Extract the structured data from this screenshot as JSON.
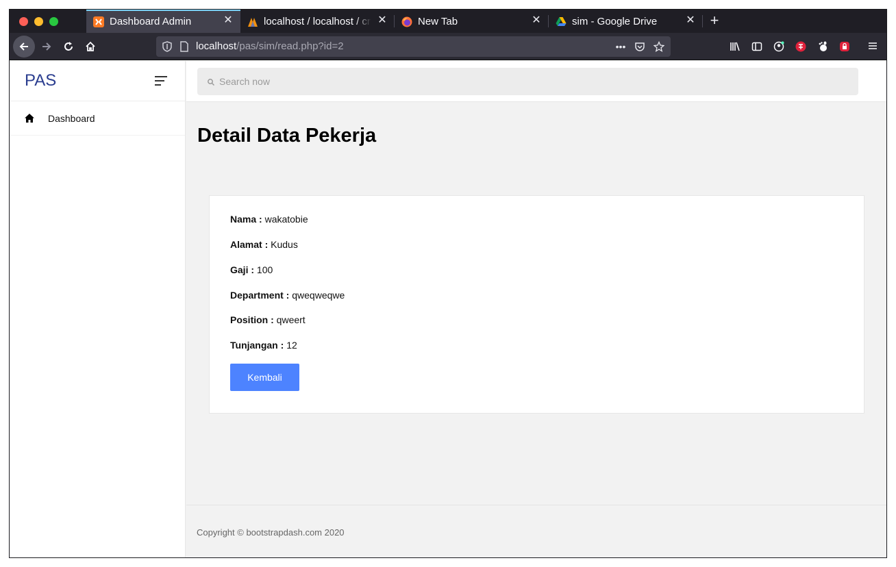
{
  "browser": {
    "tabs": [
      {
        "title": "Dashboard Admin",
        "active": true,
        "icon": "xampp-icon"
      },
      {
        "title": "localhost / localhost / crud",
        "active": false,
        "icon": "phpmyadmin-icon"
      },
      {
        "title": "New Tab",
        "active": false,
        "icon": "firefox-icon"
      },
      {
        "title": "sim - Google Drive",
        "active": false,
        "icon": "google-drive-icon"
      }
    ],
    "url_host": "localhost",
    "url_path": "/pas/sim/read.php?id=2"
  },
  "sidebar": {
    "brand": "PAS",
    "items": [
      {
        "label": "Dashboard",
        "icon": "home-icon"
      }
    ]
  },
  "search": {
    "placeholder": "Search now"
  },
  "main": {
    "title": "Detail Data Pekerja",
    "fields": [
      {
        "label": "Nama :",
        "value": "wakatobie"
      },
      {
        "label": "Alamat :",
        "value": "Kudus"
      },
      {
        "label": "Gaji :",
        "value": "100"
      },
      {
        "label": "Department :",
        "value": "qweqweqwe"
      },
      {
        "label": "Position :",
        "value": "qweert"
      },
      {
        "label": "Tunjangan :",
        "value": "12"
      }
    ],
    "back_button": "Kembali"
  },
  "footer": {
    "copyright": "Copyright © bootstrapdash.com 2020"
  },
  "colors": {
    "brand": "#2a3d8f",
    "primary_button": "#4d83ff",
    "active_tab_line": "#7bd2f7"
  }
}
